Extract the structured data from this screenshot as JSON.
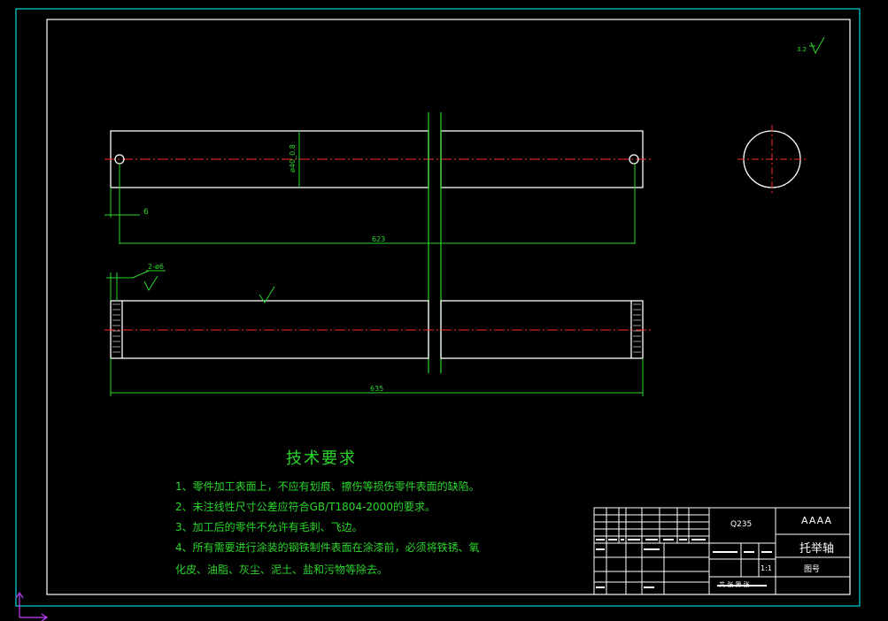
{
  "top_view": {
    "dimension_small": "6",
    "dimension_length": "623",
    "diameter_label": "ø40_0.8"
  },
  "bottom_view": {
    "hole_label": "2-ø6",
    "dimension_length": "635"
  },
  "tech_requirements": {
    "title": "技术要求",
    "items": [
      "1、零件加工表面上，不应有划痕、擦伤等损伤零件表面的缺陷。",
      "2、未注线性尺寸公差应符合GB/T1804-2000的要求。",
      "3、加工后的零件不允许有毛刺、飞边。",
      "4、所有需要进行涂装的钢铁制件表面在涂漆前，必须将铁锈、氧",
      "化皮、油脂、灰尘、泥土、盐和污物等除去。"
    ]
  },
  "title_block": {
    "material": "Q235",
    "project": "AAAA",
    "part_name": "托举轴",
    "drawing_no_label": "图号",
    "scale": "1:1",
    "sheet_row": "共 张 第 张"
  },
  "colors": {
    "background": "#000000",
    "frame": "#00ffff",
    "lines": "#ffffff",
    "dimensions": "#2bd62b",
    "centerline": "#ff2a2a"
  }
}
